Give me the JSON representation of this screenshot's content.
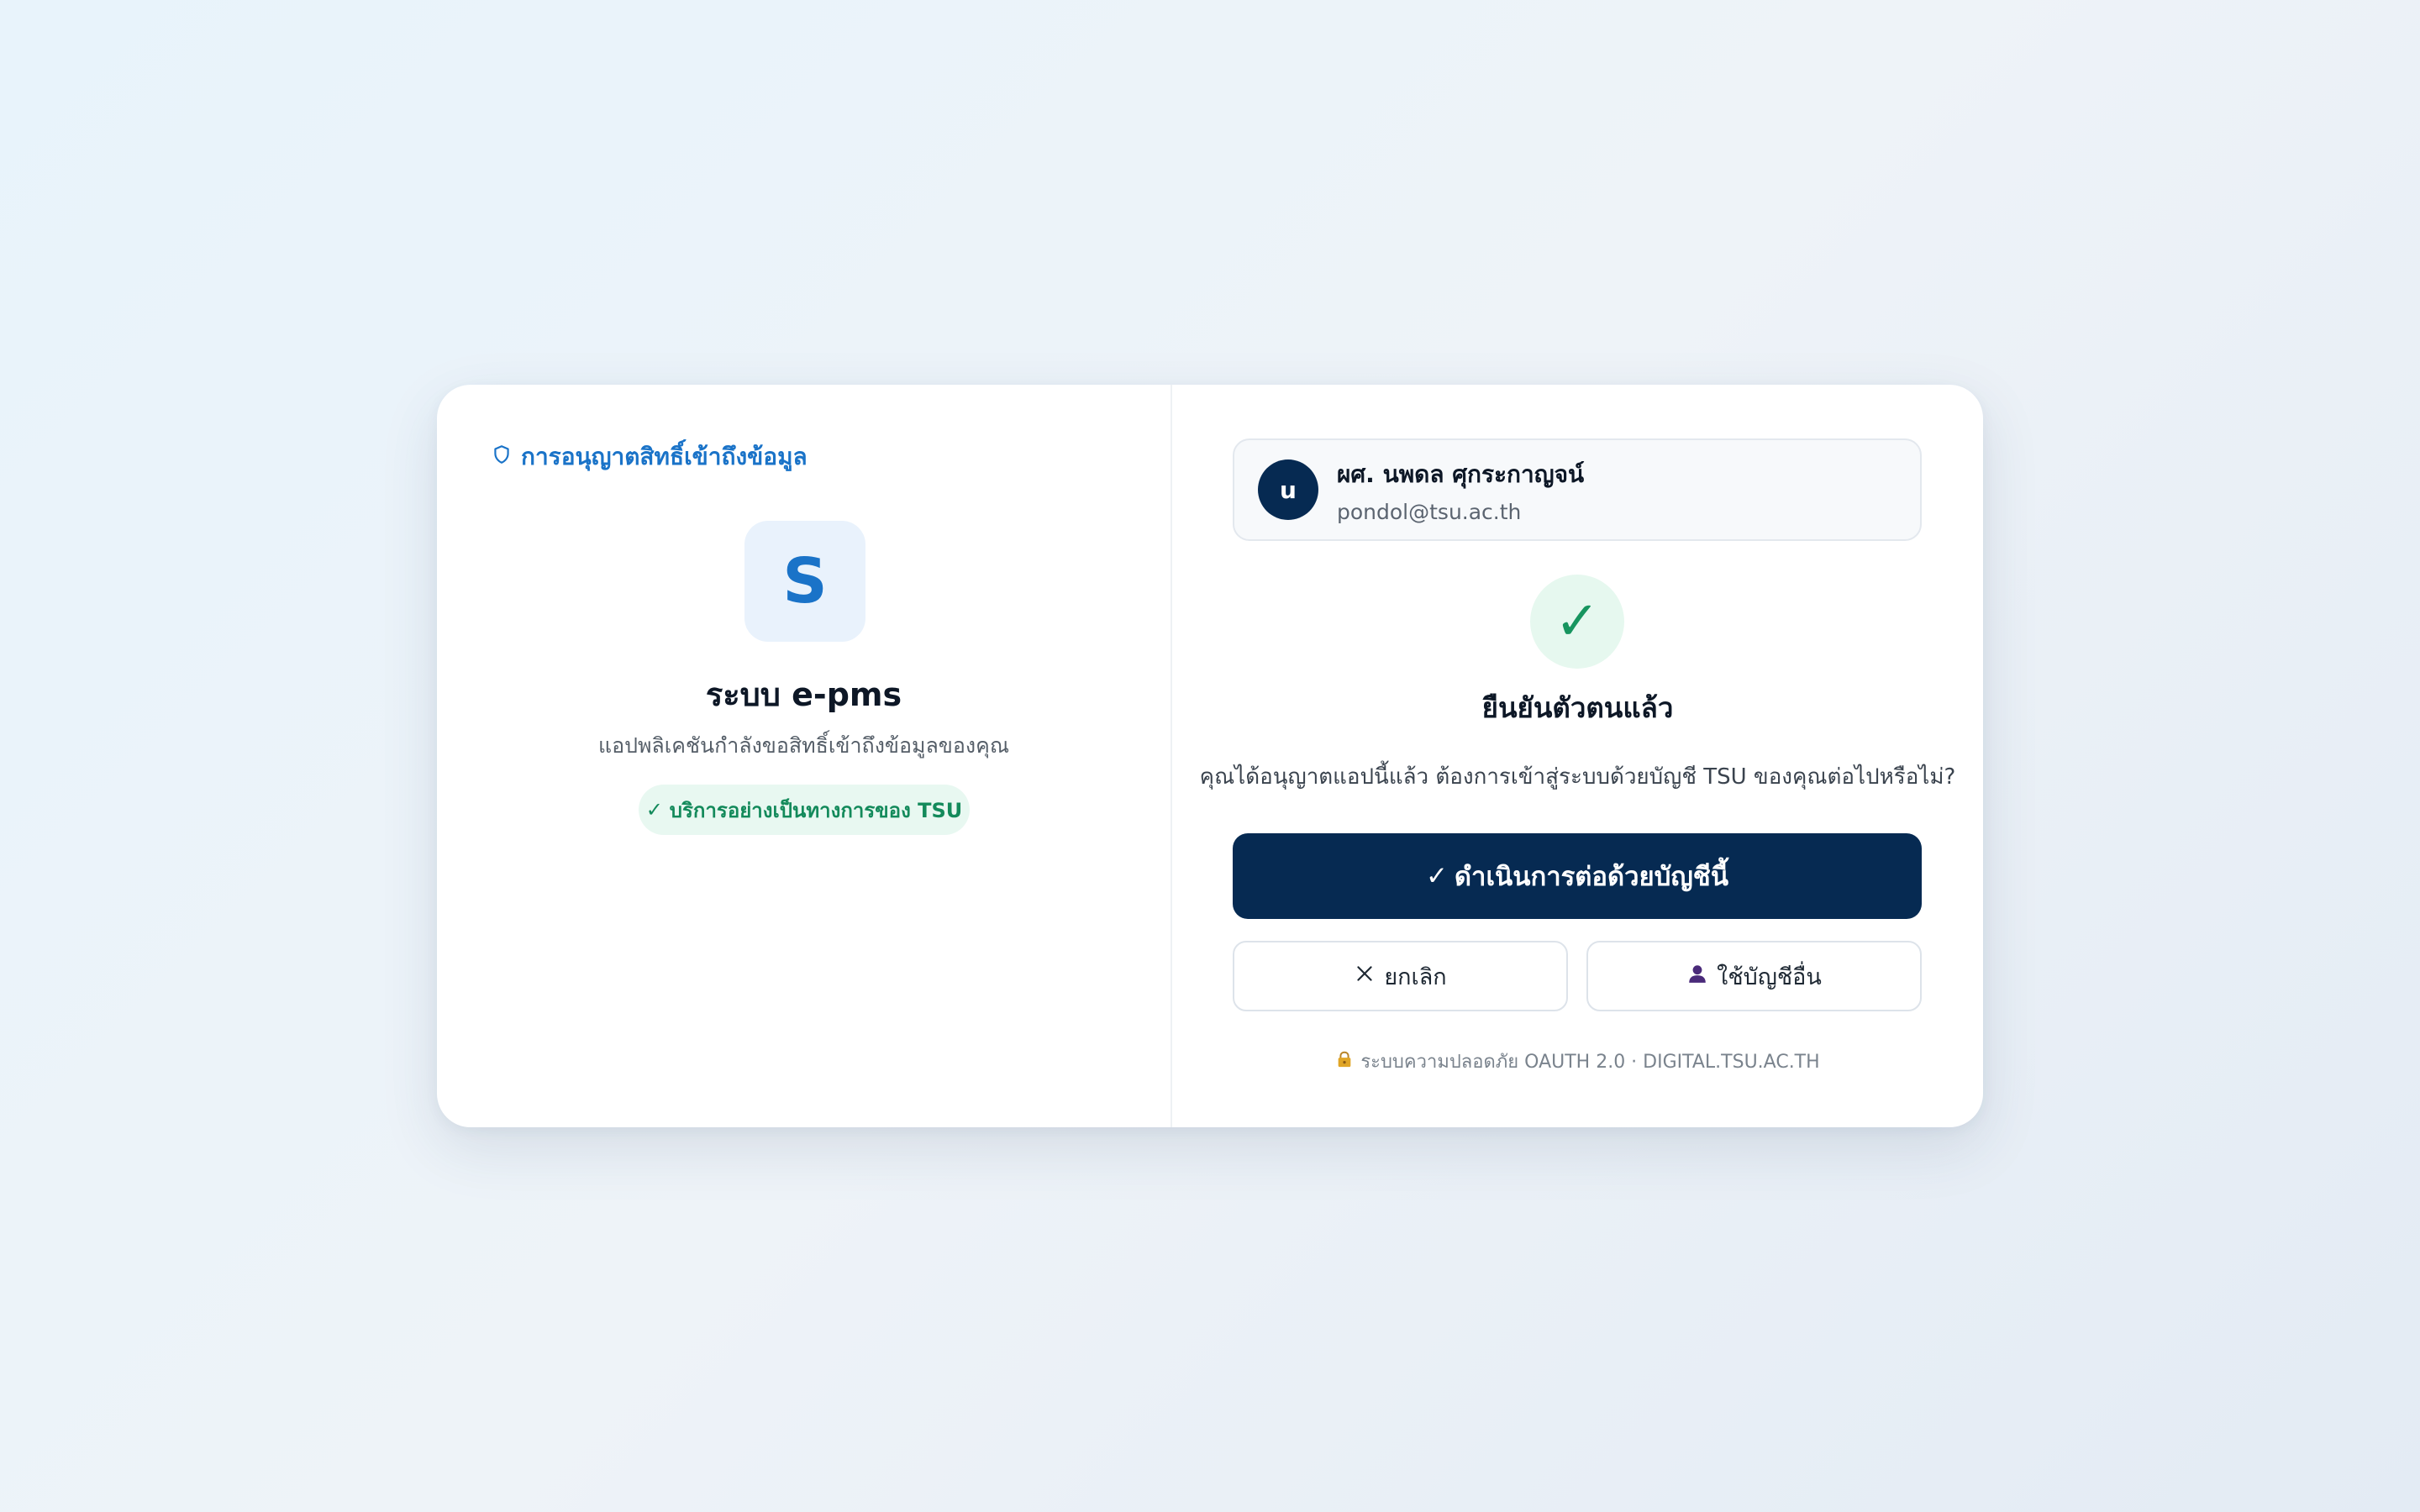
{
  "permission": {
    "header_icon": "shield-icon",
    "header": "การอนุญาตสิทธิ์เข้าถึงข้อมูล"
  },
  "app": {
    "logo_letter": "S",
    "title": "ระบบ e-pms",
    "subtitle": "แอปพลิเคชันกำลังขอสิทธิ์เข้าถึงข้อมูลของคุณ",
    "badge_check": "✓",
    "badge": "บริการอย่างเป็นทางการของ TSU"
  },
  "account": {
    "avatar_initial": "u",
    "name": "ผศ. นพดล ศุกระกาญจน์",
    "email": "pondol@tsu.ac.th"
  },
  "status": {
    "check_glyph": "✓",
    "title": "ยืนยันตัวตนแล้ว",
    "question": "คุณได้อนุญาตแอปนี้แล้ว ต้องการเข้าสู่ระบบด้วยบัญชี TSU ของคุณต่อไปหรือไม่?"
  },
  "actions": {
    "continue_check": "✓",
    "continue": "ดำเนินการต่อด้วยบัญชีนี้",
    "cancel_icon": "close-icon",
    "cancel": "ยกเลิก",
    "other_icon": "user-icon",
    "other_account": "ใช้บัญชีอื่น"
  },
  "footer": {
    "lock_icon": "lock-icon",
    "note": "ระบบความปลอดภัย OAUTH 2.0 · DIGITAL.TSU.AC.TH"
  },
  "colors": {
    "brand_navy": "#062a52",
    "accent_blue": "#1a73c8",
    "success_green": "#17955f",
    "lock_gold": "#e0a526",
    "user_icon_purple": "#4a2a7a"
  }
}
